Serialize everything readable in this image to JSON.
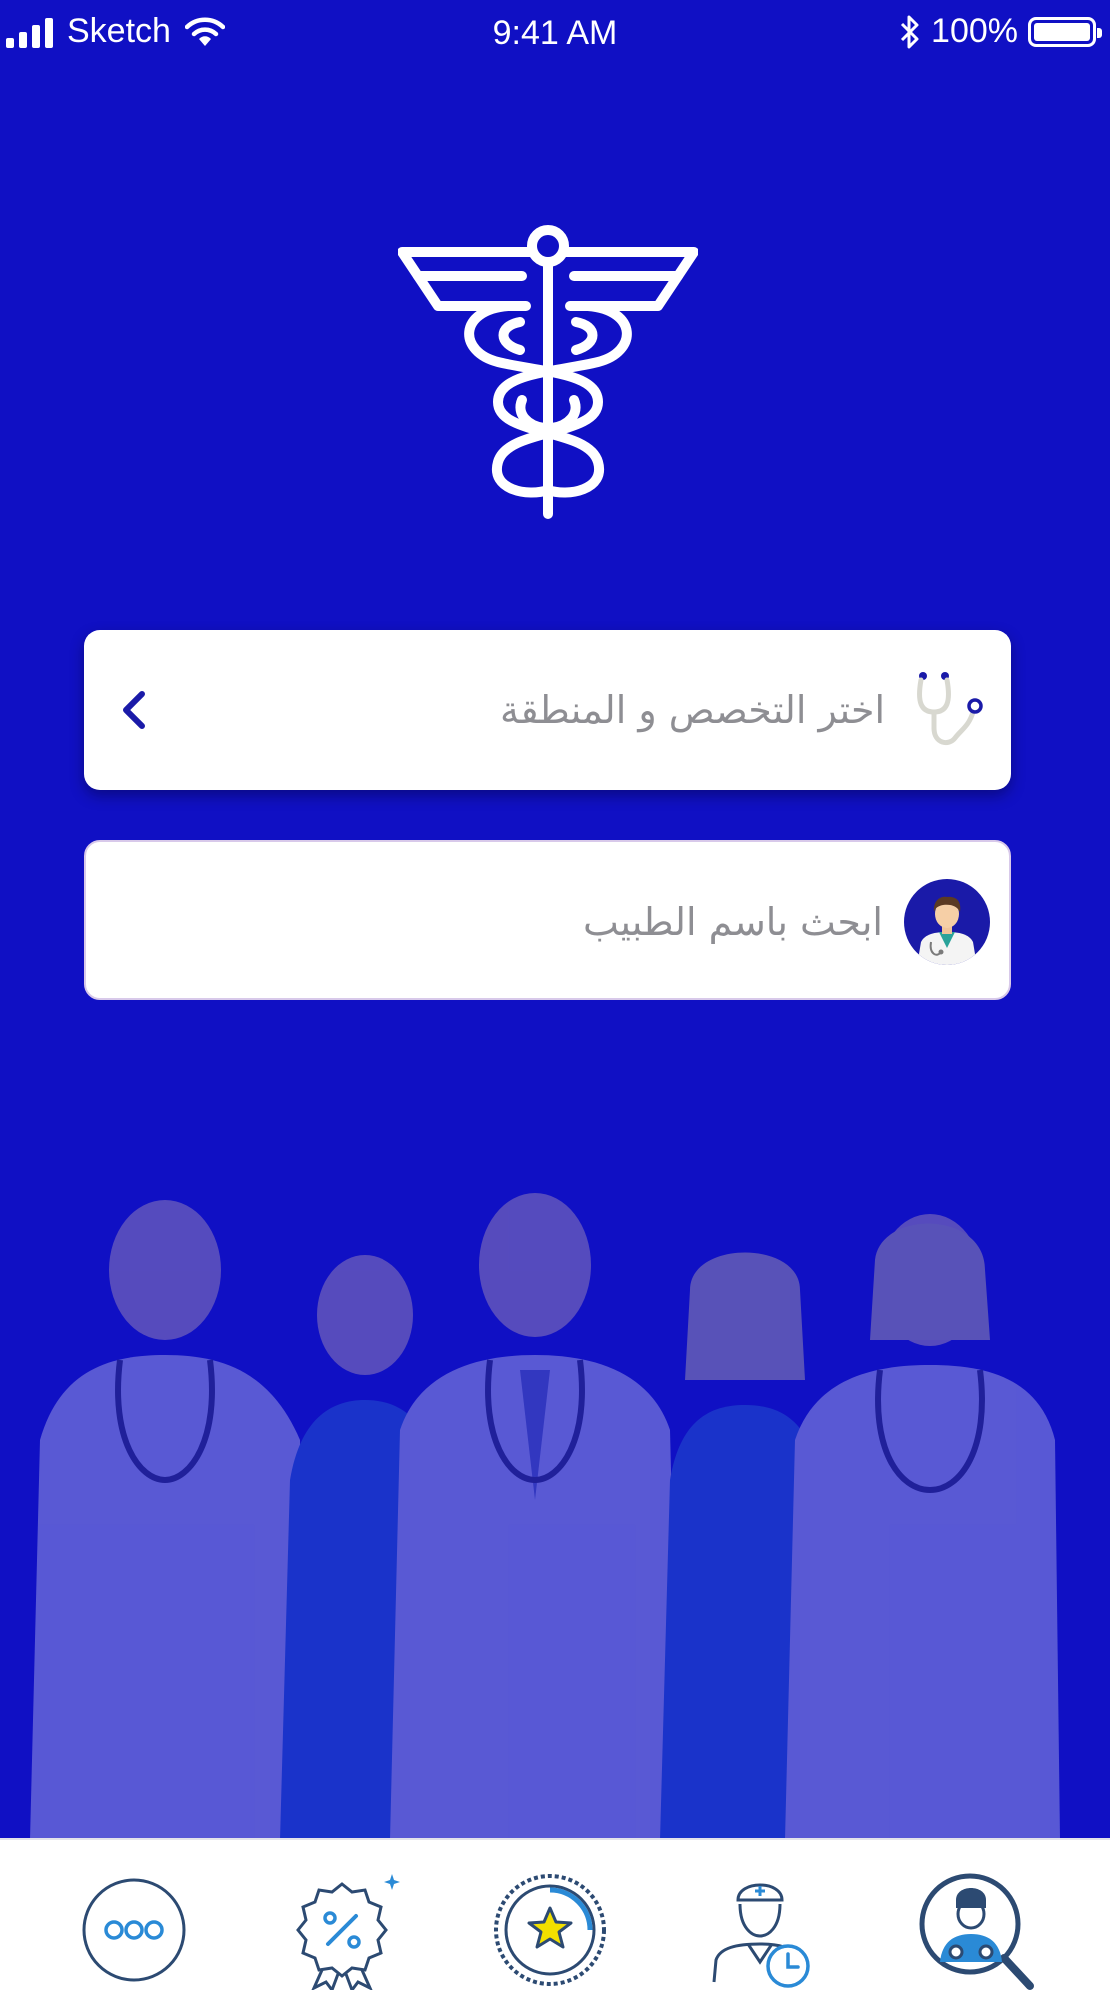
{
  "status_bar": {
    "carrier": "Sketch",
    "time": "9:41 AM",
    "battery": "100%",
    "icons": [
      "signal-icon",
      "wifi-icon",
      "bluetooth-icon",
      "battery-icon"
    ]
  },
  "logo": {
    "icon": "caduceus-icon"
  },
  "search": {
    "specialty_region_label": "اختر التخصص و المنطقة",
    "doctor_name_label": "ابحث باسم الطبيب"
  },
  "tab_bar": {
    "tabs": [
      {
        "icon": "more-icon"
      },
      {
        "icon": "discount-badge-icon"
      },
      {
        "icon": "favorites-star-icon"
      },
      {
        "icon": "appointments-icon"
      },
      {
        "icon": "doctor-search-icon"
      }
    ]
  },
  "colors": {
    "background": "#1010c4",
    "field_text": "#8e8e93",
    "tab_icon": "#2c4a72",
    "tab_accent": "#2a8ad6"
  }
}
